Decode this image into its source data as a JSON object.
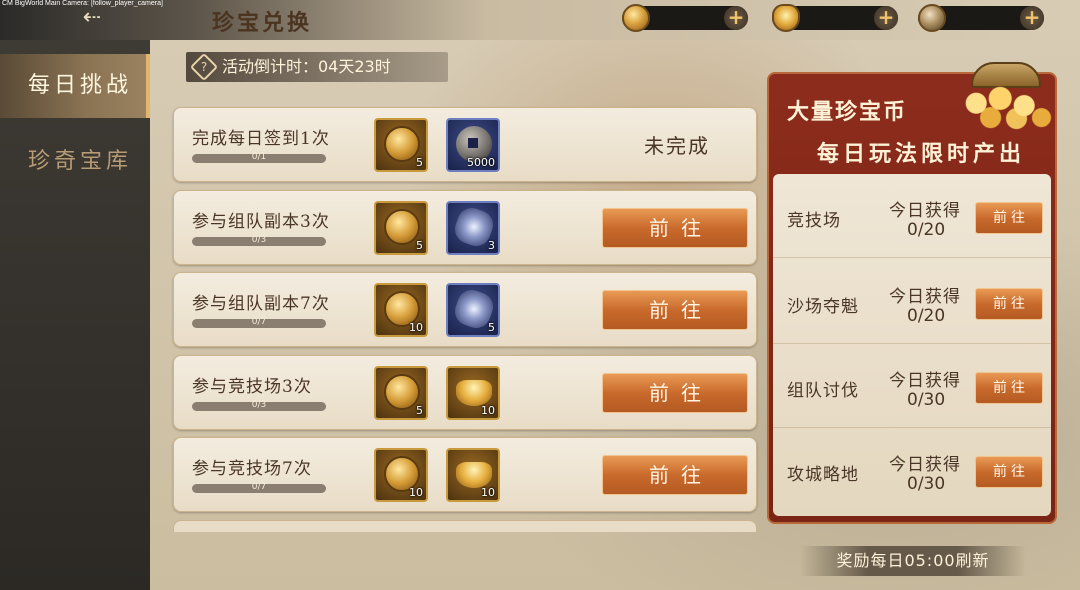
{
  "debug_label": "CM BigWorld Main Camera: [follow_player_camera]",
  "header": {
    "title": "珍宝兑换",
    "back_icon": "back-arrow-icon",
    "currencies": [
      {
        "icon": "treasure-coin-icon",
        "value": ""
      },
      {
        "icon": "gold-ingot-icon",
        "value": ""
      },
      {
        "icon": "ancient-coin-icon",
        "value": ""
      }
    ],
    "plus_label": "+"
  },
  "sidebar": {
    "items": [
      {
        "label": "每日挑战",
        "active": true
      },
      {
        "label": "珍奇宝库",
        "active": false
      }
    ]
  },
  "countdown": {
    "icon_label": "?",
    "text": "活动倒计时：04天23时"
  },
  "tasks": [
    {
      "name": "完成每日签到1次",
      "progress_text": "0/1",
      "progress": 0,
      "rewards": [
        {
          "icon": "treasure-coin-icon",
          "qty": "5",
          "frame": "gold"
        },
        {
          "icon": "ancient-coin-icon",
          "qty": "5000",
          "frame": "blue"
        }
      ],
      "status": "未完成",
      "button": null
    },
    {
      "name": "参与组队副本3次",
      "progress_text": "0/3",
      "progress": 0,
      "rewards": [
        {
          "icon": "treasure-coin-icon",
          "qty": "5",
          "frame": "gold"
        },
        {
          "icon": "crystal-icon",
          "qty": "3",
          "frame": "blue"
        }
      ],
      "status": null,
      "button": "前往"
    },
    {
      "name": "参与组队副本7次",
      "progress_text": "0/7",
      "progress": 0,
      "rewards": [
        {
          "icon": "treasure-coin-icon",
          "qty": "10",
          "frame": "gold"
        },
        {
          "icon": "crystal-icon",
          "qty": "5",
          "frame": "blue"
        }
      ],
      "status": null,
      "button": "前往"
    },
    {
      "name": "参与竞技场3次",
      "progress_text": "0/3",
      "progress": 0,
      "rewards": [
        {
          "icon": "treasure-coin-icon",
          "qty": "5",
          "frame": "gold"
        },
        {
          "icon": "gold-ingot-icon",
          "qty": "10",
          "frame": "gold"
        }
      ],
      "status": null,
      "button": "前往"
    },
    {
      "name": "参与竞技场7次",
      "progress_text": "0/7",
      "progress": 0,
      "rewards": [
        {
          "icon": "treasure-coin-icon",
          "qty": "10",
          "frame": "gold"
        },
        {
          "icon": "gold-ingot-icon",
          "qty": "10",
          "frame": "gold"
        }
      ],
      "status": null,
      "button": "前往"
    }
  ],
  "side_panel": {
    "title_line1": "大量珍宝币",
    "title_line2": "每日玩法限时产出",
    "chest_icon": "treasure-chest-icon",
    "sources": [
      {
        "name": "竞技场",
        "label": "今日获得",
        "count": "0/20",
        "button": "前往"
      },
      {
        "name": "沙场夺魁",
        "label": "今日获得",
        "count": "0/20",
        "button": "前往"
      },
      {
        "name": "组队讨伐",
        "label": "今日获得",
        "count": "0/30",
        "button": "前往"
      },
      {
        "name": "攻城略地",
        "label": "今日获得",
        "count": "0/30",
        "button": "前往"
      }
    ]
  },
  "footer": {
    "refresh_text": "奖励每日05:00刷新"
  }
}
